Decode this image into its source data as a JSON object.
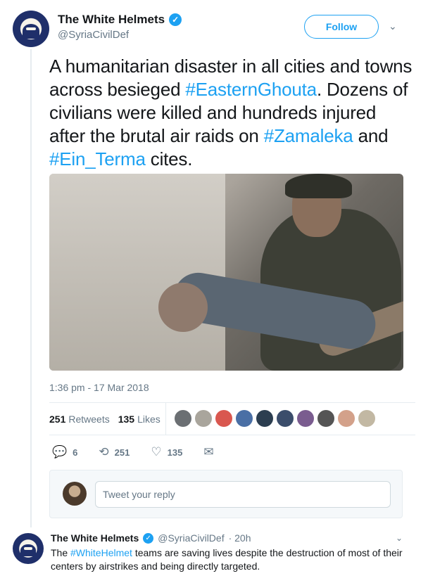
{
  "tweet": {
    "author": {
      "name": "The White Helmets",
      "handle": "@SyriaCivilDef",
      "verified_icon": "verified-badge-icon"
    },
    "follow_label": "Follow",
    "text": {
      "p1": "A humanitarian disaster in all cities and towns across besieged ",
      "h1": "#EasternGhouta",
      "p2": ". Dozens of civilians were killed and hundreds injured after the brutal air raids on ",
      "h2": "#Zamaleka",
      "p3": " and ",
      "h3": "#Ein_Terma",
      "p4": " cites."
    },
    "timestamp": "1:36 pm - 17 Mar 2018",
    "stats": {
      "retweets_count": "251",
      "retweets_label": "Retweets",
      "likes_count": "135",
      "likes_label": "Likes"
    },
    "actions": {
      "reply_count": "6",
      "retweet_count": "251",
      "like_count": "135"
    }
  },
  "likers_colors": [
    "#6b6f73",
    "#a9a59c",
    "#d9574f",
    "#4a6fa5",
    "#2c3e50",
    "#3b4d6b",
    "#7a5c8f",
    "#555555",
    "#d3a18a",
    "#c2b8a3"
  ],
  "reply_box": {
    "placeholder": "Tweet your reply"
  },
  "reply_tweet": {
    "name": "The White Helmets",
    "handle": "@SyriaCivilDef",
    "time": "· 20h",
    "text_p1": "The ",
    "text_hashtag": "#WhiteHelmet",
    "text_p2": " teams are saving lives despite the destruction of most of their centers by airstrikes and being directly targeted."
  },
  "colors": {
    "accent": "#1da1f2",
    "text": "#14171a",
    "muted": "#657786"
  }
}
